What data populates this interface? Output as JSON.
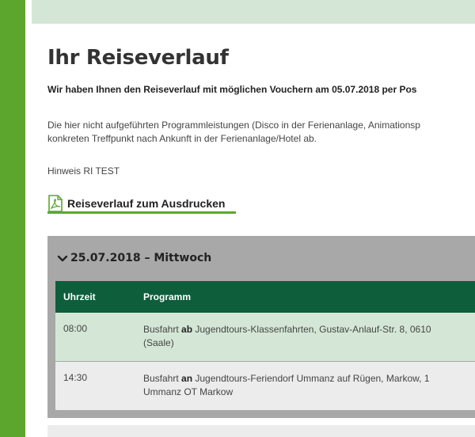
{
  "page": {
    "title": "Ihr Reiseverlauf",
    "lead": "Wir haben Ihnen den Reiseverlauf mit möglichen Vouchern am 05.07.2018 per Pos",
    "description_lines": [
      "Die hier nicht aufgeführten Programmleistungen (Disco in der Ferienanlage, Animationsp",
      "konkreten Treffpunkt nach Ankunft in der Ferienanlage/Hotel ab."
    ],
    "hint": "Hinweis RI TEST",
    "pdf_link_label": "Reiseverlauf zum Ausdrucken"
  },
  "itinerary": {
    "day_title": "25.07.2018 – Mittwoch",
    "columns": {
      "time": "Uhrzeit",
      "program": "Programm"
    },
    "rows": [
      {
        "time": "08:00",
        "prefix": "Busfahrt ",
        "bold": "ab",
        "rest": " Jugendtours-Klassenfahrten, Gustav-Anlauf-Str. 8, 0610",
        "line2": "(Saale)"
      },
      {
        "time": "14:30",
        "prefix": "Busfahrt ",
        "bold": "an",
        "rest": " Jugendtours-Feriendorf Ummanz auf Rügen, Markow, 1",
        "line2": "Ummanz OT Markow"
      }
    ]
  },
  "colors": {
    "accent_green": "#5da62e",
    "table_header": "#0e5e3c",
    "light_green": "#d4e7d6",
    "panel_gray": "#a8a8a8"
  },
  "icons": {
    "pdf": "pdf-icon",
    "collapse": "chevron-down-icon"
  }
}
